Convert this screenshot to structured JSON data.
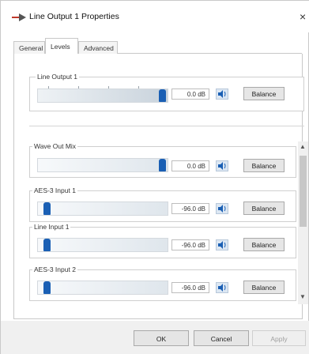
{
  "window": {
    "title": "Line Output 1 Properties",
    "close_glyph": "×"
  },
  "tabs": [
    {
      "label": "General"
    },
    {
      "label": "Levels"
    },
    {
      "label": "Advanced"
    }
  ],
  "master": {
    "label": "Line Output 1",
    "value": "0.0 dB",
    "level_fraction": 1.0,
    "balance_label": "Balance"
  },
  "channels": [
    {
      "label": "Wave Out Mix",
      "value": "0.0 dB",
      "level_fraction": 1.0,
      "balance_label": "Balance"
    },
    {
      "label": "AES-3 Input 1",
      "value": "-96.0 dB",
      "level_fraction": 0.0,
      "balance_label": "Balance"
    },
    {
      "label": "Line Input 1",
      "value": "-96.0 dB",
      "level_fraction": 0.0,
      "balance_label": "Balance"
    },
    {
      "label": "AES-3 Input 2",
      "value": "-96.0 dB",
      "level_fraction": 0.0,
      "balance_label": "Balance"
    }
  ],
  "footer": {
    "ok_label": "OK",
    "cancel_label": "Cancel",
    "apply_label": "Apply"
  },
  "colors": {
    "accent": "#1a5fb4"
  },
  "icons": {
    "title": "output-arrow-icon",
    "speaker": "speaker-icon"
  }
}
